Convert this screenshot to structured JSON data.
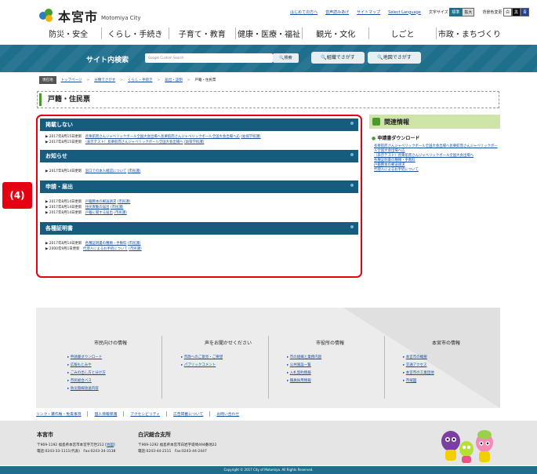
{
  "header": {
    "logo_ja": "本宮市",
    "logo_en": "Motomiya City",
    "utility": [
      "はじめての方へ",
      "音声読みあげ",
      "サイトマップ",
      "Select Language"
    ],
    "font_size_label": "文字サイズ",
    "font_std": "標準",
    "font_big": "拡大",
    "bg_label": "背景色変更",
    "bg_white": "白",
    "bg_black": "黒",
    "bg_blue": "青"
  },
  "gnav": [
    "防災・安全",
    "くらし・手続き",
    "子育て・教育",
    "健康・医療・福祉",
    "観光・文化",
    "しごと",
    "市政・まちづくり"
  ],
  "search": {
    "title": "サイト内検索",
    "placeholder": "Google Custom Search",
    "button": "検索",
    "org_button": "組織でさがす",
    "map_button": "地図でさがす"
  },
  "breadcrumb": {
    "here": "現在地",
    "items": [
      "トップページ",
      "分類でさがす",
      "くらし・手続き",
      "届出・証明",
      "戸籍・住民票"
    ]
  },
  "page_title": "戸籍・住民票",
  "annotation": "(4)",
  "sections": [
    {
      "title": "掲載しない",
      "items": [
        {
          "date": "2017年8月15日更新",
          "text": "長栗航而さんジャベリックボール全国大会出場へ長栗航而さんジャベリックボール全国大会出場へ応",
          "dept": "(幼保学校課)"
        },
        {
          "date": "2017年8月15日更新",
          "text": "（表示テスト）長栗航而さんジャベリックボール全国大会出場へ",
          "dept": "(幼保学校課)"
        }
      ]
    },
    {
      "title": "お知らせ",
      "items": [
        {
          "date": "2017年8月14日更新",
          "text": "窓口での本人確認について",
          "dept": "(市民課)"
        }
      ]
    },
    {
      "title": "申請・届出",
      "items": [
        {
          "date": "2017年8月14日更新",
          "text": "戸籍謄本の郵送請求",
          "dept": "(市民課)"
        },
        {
          "date": "2017年8月14日更新",
          "text": "住民異動の届出",
          "dept": "(市民課)"
        },
        {
          "date": "2017年8月14日更新",
          "text": "戸籍に関する届出",
          "dept": "(市民課)"
        }
      ]
    },
    {
      "title": "各種証明書",
      "items": [
        {
          "date": "2017年8月14日更新",
          "text": "各種証明書の種類・手数料",
          "dept": "(市民課)"
        },
        {
          "date": "2000年9月1日更新",
          "text": "代理人によるお手続について",
          "dept": "(市民課)"
        }
      ]
    }
  ],
  "sidebar": {
    "title": "関連情報",
    "sub": "申請書ダウンロード",
    "links": [
      "長栗航而さんジャベリックボール全国大会出場へ長栗航而さんジャベリックボール全国大会出場へ応",
      "（表示テスト）長栗航而さんジャベリックボール全国大会出場へ",
      "各種証明書の種類・手数料",
      "戸籍謄本の郵送請求",
      "代理人によるお手続について"
    ]
  },
  "footer": {
    "columns": [
      {
        "title": "市民向けの情報",
        "links": [
          "申請書ダウンロード",
          "広報もとみや",
          "ごみの出し方と分け方",
          "市民総合バス",
          "防災無線放送内容"
        ]
      },
      {
        "title": "声をお聞かせください",
        "links": [
          "市政へのご意見・ご要望",
          "パブリックコメント"
        ]
      },
      {
        "title": "市役所の情報",
        "links": [
          "市の組織と業務内容",
          "公共施設一覧",
          "入札契約情報",
          "職員採用情報"
        ]
      },
      {
        "title": "本宮市の情報",
        "links": [
          "本宮市の概要",
          "交通アクセス",
          "本宮市の工業団地",
          "市域図"
        ]
      }
    ],
    "links": [
      "リンク・著作権・免責事項",
      "個人情報保護",
      "アクセシビリティ",
      "広告掲載について",
      "お問い合わせ"
    ],
    "office1": {
      "name": "本宮市",
      "addr": "〒969-1192 福島県本宮市本宮字万世212 [",
      "map": "地図",
      "addr_end": "]",
      "tel": "電話:0243-33-1111(代表)　Fax:0243-34-3138"
    },
    "office2": {
      "name": "白沢総合支所",
      "addr": "〒969-1292 福島県本宮市白岩字堤崎494番地22",
      "tel": "電話:0243-44-2111　Fax:0243-44-2447"
    },
    "copyright": "Copyright © 2017 City of Motomiya. All Rights Reserved."
  },
  "colors": {
    "accent": "#175b7e",
    "highlight": "#e50012",
    "green": "#4a9b2e"
  }
}
